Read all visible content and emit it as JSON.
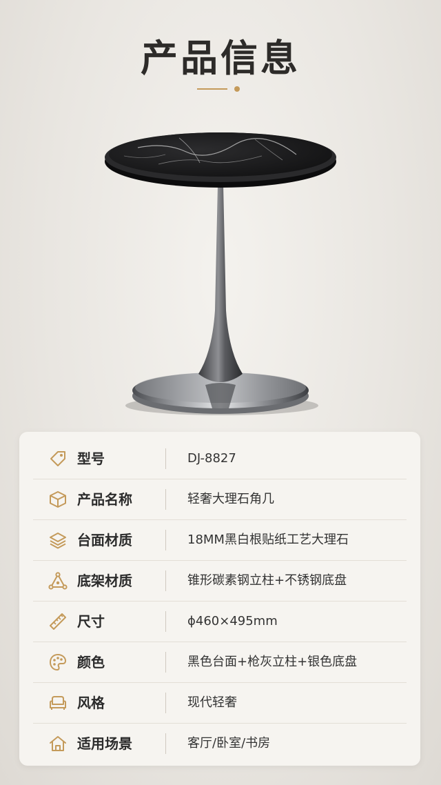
{
  "header": {
    "title": "产品信息"
  },
  "specs": [
    {
      "icon": "tag-icon",
      "label": "型号",
      "value": "DJ-8827"
    },
    {
      "icon": "box-icon",
      "label": "产品名称",
      "value": "轻奢大理石角几"
    },
    {
      "icon": "layers-icon",
      "label": "台面材质",
      "value": "18MM黑白根贴纸工艺大理石"
    },
    {
      "icon": "structure-icon",
      "label": "底架材质",
      "value": "锥形碳素钢立柱+不锈钢底盘"
    },
    {
      "icon": "ruler-icon",
      "label": "尺寸",
      "value": "ϕ460×495mm"
    },
    {
      "icon": "palette-icon",
      "label": "颜色",
      "value": "黑色台面+枪灰立柱+银色底盘"
    },
    {
      "icon": "sofa-icon",
      "label": "风格",
      "value": "现代轻奢"
    },
    {
      "icon": "home-icon",
      "label": "适用场景",
      "value": "客厅/卧室/书房"
    }
  ],
  "colors": {
    "accent": "#c49a5a",
    "text": "#2b2b2b",
    "background": "#ece9e4"
  }
}
